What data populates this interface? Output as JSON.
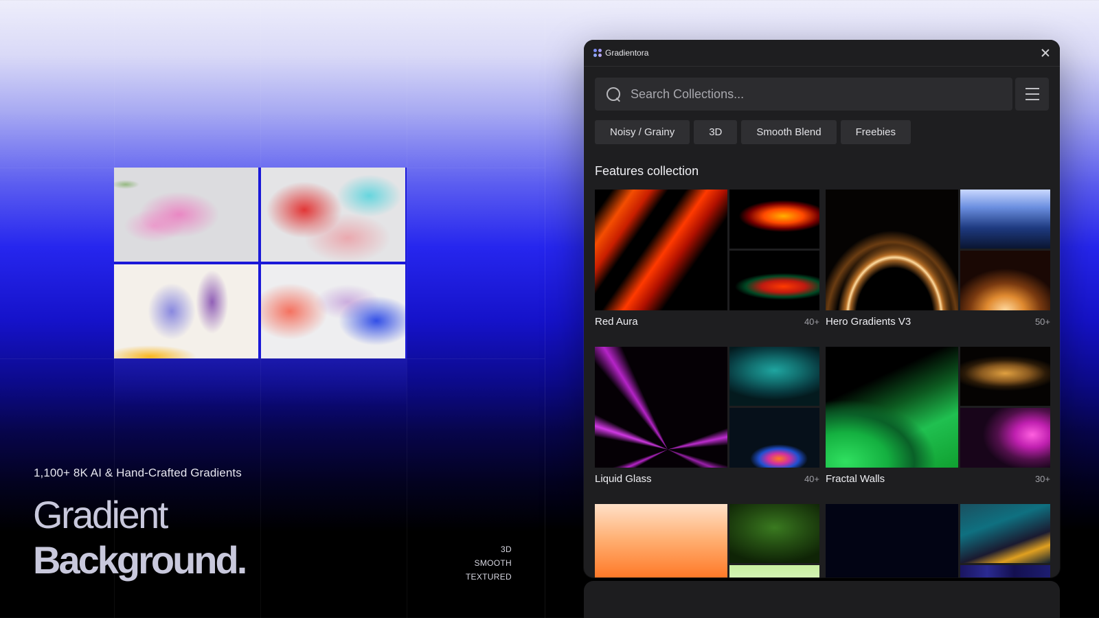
{
  "hero": {
    "subtitle": "1,100+ 8K AI & Hand-Crafted Gradients",
    "title_line_1": "Gradient",
    "title_line_2": "Background.",
    "tags": [
      "3D",
      "SMOOTH",
      "TEXTURED"
    ]
  },
  "window": {
    "app_title": "Gradientora",
    "search": {
      "placeholder": "Search Collections...",
      "value": ""
    },
    "chips": [
      "Noisy / Grainy",
      "3D",
      "Smooth Blend",
      "Freebies"
    ],
    "section_title": "Features collection",
    "collections": [
      {
        "name": "Red Aura",
        "count": "40+"
      },
      {
        "name": "Hero Gradients V3",
        "count": "50+"
      },
      {
        "name": "Liquid Glass",
        "count": "40+"
      },
      {
        "name": "Fractal Walls",
        "count": "30+"
      },
      {
        "name": "",
        "count": ""
      },
      {
        "name": "",
        "count": ""
      }
    ]
  },
  "colors": {
    "window_bg": "#1e1e20",
    "chip_bg": "#2f2f32",
    "accent_blue": "#2626ee"
  },
  "icons": [
    "logo-icon",
    "close-icon",
    "search-icon",
    "menu-icon"
  ]
}
